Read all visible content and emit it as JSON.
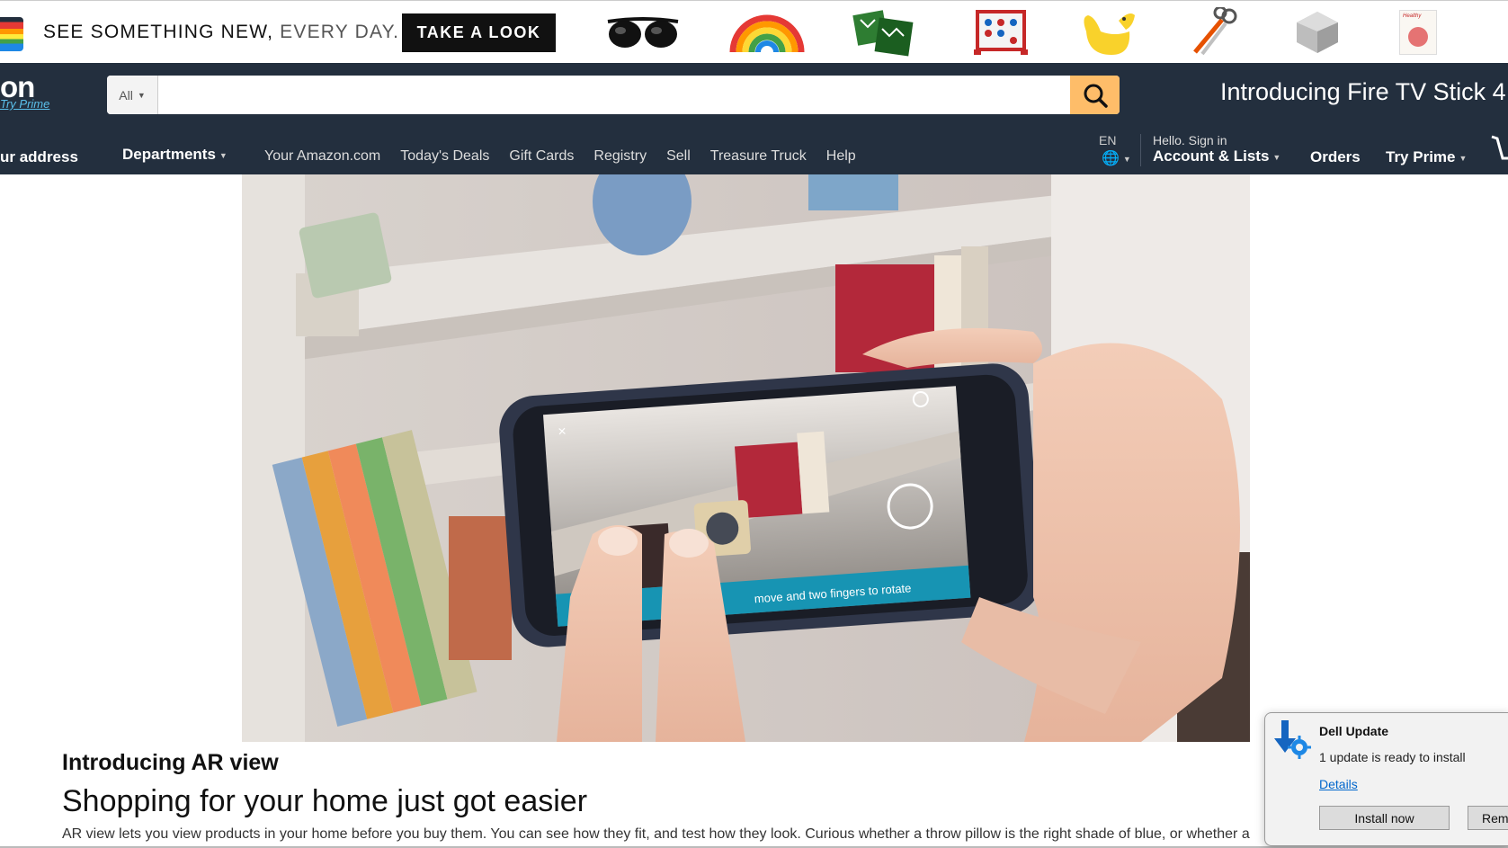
{
  "promo": {
    "tagline_bold": "SEE SOMETHING NEW,",
    "tagline_light": " EVERY DAY.",
    "cta_label": "TAKE A LOOK",
    "products": [
      "sunglasses-icon",
      "rainbow-icon",
      "pillows-icon",
      "connect-four-icon",
      "duck-watering-can-icon",
      "scissors-icon",
      "geode-speaker-icon",
      "cookbook-icon"
    ],
    "cookbook_text": "Healthy"
  },
  "nav": {
    "logo_fragment": "on",
    "try_prime": "Try Prime",
    "search_category": "All",
    "search_placeholder": "",
    "promo_text": "Introducing Fire TV Stick 4",
    "address_label": "ur address",
    "departments_label": "Departments",
    "links": [
      "Your Amazon.com",
      "Today's Deals",
      "Gift Cards",
      "Registry",
      "Sell",
      "Treasure Truck",
      "Help"
    ],
    "language": "EN",
    "hello": "Hello. Sign in",
    "account_lists": "Account & Lists",
    "orders": "Orders",
    "try_prime_menu": "Try Prime",
    "colors": {
      "nav_bg": "#232f3e",
      "search_btn": "#febd69"
    }
  },
  "hero": {
    "phone_caption": "move and two fingers to rotate"
  },
  "article": {
    "heading": "Introducing AR view",
    "subheading": "Shopping for your home just got easier",
    "body": "AR view lets you view products in your home before you buy them. You can see how they fit, and test how they look. Curious whether a throw pillow is the right shade of blue, or whether a"
  },
  "toast": {
    "title": "Dell Update",
    "message": "1 update is ready to install",
    "details": "Details",
    "install": "Install now",
    "remind": "Rem"
  }
}
